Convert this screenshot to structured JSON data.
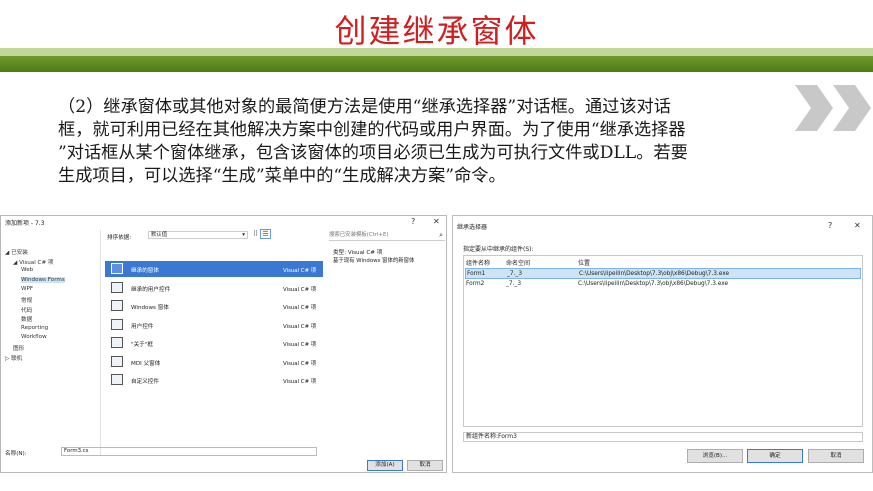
{
  "slide": {
    "title": "创建继承窗体",
    "paragraph_lines": [
      "（2）继承窗体或其他对象的最简便方法是使用“继承选择器”对话框。通过该对话",
      "框，就可利用已经在其他解决方案中创建的代码或用户界面。为了使用“继承选择器",
      "”对话框从某个窗体继承，包含该窗体的项目必须已生成为可执行文件或DLL。若要",
      "生成项目，可以选择“生成”菜单中的“生成解决方案”命令。"
    ]
  },
  "add_dialog": {
    "title": "添加新项 - 7.3",
    "help_btn": "?",
    "close_btn": "✕",
    "tree": [
      {
        "label": "◢ 已安装",
        "indent": 0
      },
      {
        "label": "◢ Visual C# 项",
        "indent": 1
      },
      {
        "label": "Web",
        "indent": 2
      },
      {
        "label": "Windows Forms",
        "indent": 2,
        "selected": true
      },
      {
        "label": "WPF",
        "indent": 2
      },
      {
        "label": "常规",
        "indent": 2
      },
      {
        "label": "代码",
        "indent": 2
      },
      {
        "label": "数据",
        "indent": 2
      },
      {
        "label": "Reporting",
        "indent": 2
      },
      {
        "label": "Workflow",
        "indent": 2
      },
      {
        "label": "图形",
        "indent": 1
      },
      {
        "label": "▷ 联机",
        "indent": 0
      }
    ],
    "sort_label": "排序依据:",
    "sort_value": "默认值",
    "templates": [
      {
        "name": "继承的窗体",
        "type": "Visual C# 项",
        "selected": true
      },
      {
        "name": "继承的用户控件",
        "type": "Visual C# 项"
      },
      {
        "name": "Windows 窗体",
        "type": "Visual C# 项"
      },
      {
        "name": "用户控件",
        "type": "Visual C# 项"
      },
      {
        "name": "\"关于\"框",
        "type": "Visual C# 项"
      },
      {
        "name": "MDI 父窗体",
        "type": "Visual C# 项"
      },
      {
        "name": "自定义控件",
        "type": "Visual C# 项"
      }
    ],
    "search_placeholder": "搜索已安装模板(Ctrl+E)",
    "type_line": "类型:  Visual C# 项",
    "description": "基于现有 Windows 窗体的新窗体",
    "name_label": "名称(N):",
    "name_value": "Form3.cs",
    "add_button": "添加(A)",
    "cancel_button": "取消"
  },
  "inherit_dialog": {
    "title": "继承选择器",
    "help_btn": "?",
    "close_btn": "✕",
    "label": "指定要从中继承的组件(S):",
    "columns": [
      "组件名称",
      "命名空间",
      "位置"
    ],
    "rows": [
      [
        "Form1",
        "_7._3",
        "C:\\Users\\lipeilin\\Desktop\\7.3\\obj\\x86\\Debug\\7.3.exe"
      ],
      [
        "Form2",
        "_7._3",
        "C:\\Users\\lipeilin\\Desktop\\7.3\\obj\\x86\\Debug\\7.3.exe"
      ]
    ],
    "selected_row": 0,
    "new_component": "新组件名称:Form3",
    "browse_button": "浏览(B)...",
    "ok_button": "确定",
    "cancel_button": "取消"
  }
}
